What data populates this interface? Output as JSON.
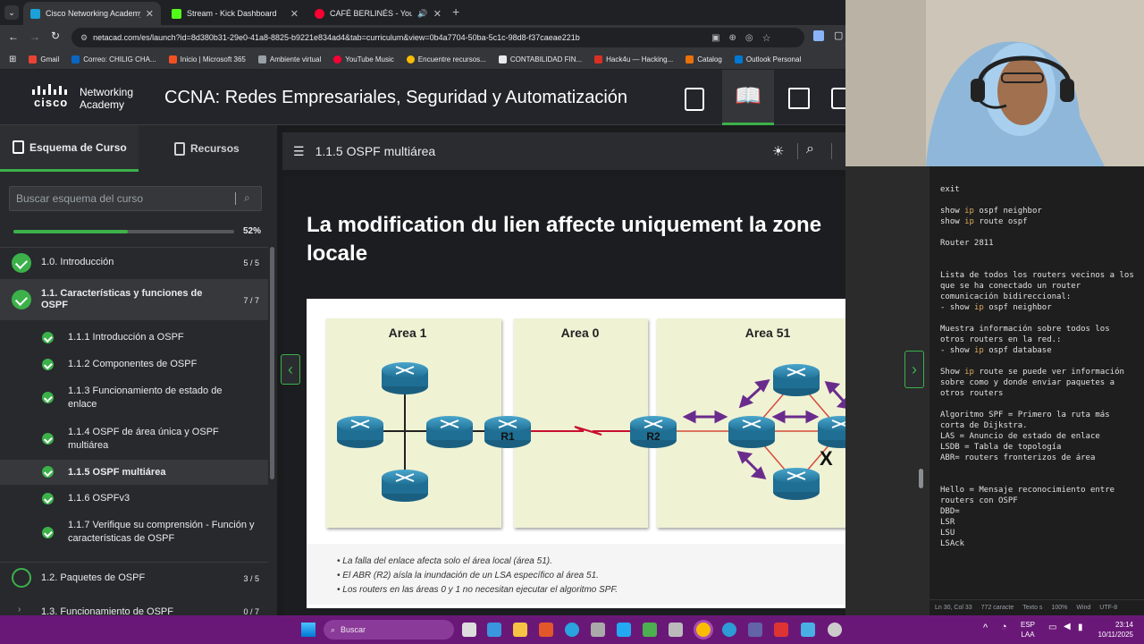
{
  "browser": {
    "tabs": [
      {
        "title": "Cisco Networking Academy: CC",
        "color": "#1ba0d7",
        "active": true
      },
      {
        "title": "Stream - Kick Dashboard",
        "color": "#53fc18",
        "active": false
      },
      {
        "title": "CAFÉ BERLINÉS - YouTube",
        "color": "#ff0033",
        "active": false
      }
    ],
    "new_tab": "+",
    "url": "netacad.com/es/launch?id=8d380b31-29e0-41a8-8825-b9221e834ad4&tab=curriculum&view=0b4a7704-50ba-5c1c-98d8-f37caeae221b",
    "bookmarks": [
      "Gmail",
      "Correo: CHILIG CHA...",
      "Inicio | Microsoft 365",
      "Ambiente virtual",
      "YouTube Music",
      "Encuentre recursos...",
      "CONTABILIDAD FIN...",
      "Hack4u — Hacking...",
      "Catalog",
      "Outlook Personal"
    ]
  },
  "app": {
    "logo_brand": "cisco",
    "logo_line1": "Networking",
    "logo_line2": "Academy",
    "course_title": "CCNA: Redes Empresariales, Seguridad y Automatización"
  },
  "sidebar": {
    "tab_outline": "Esquema de Curso",
    "tab_resources": "Recursos",
    "search_placeholder": "Buscar esquema del curso",
    "progress_label": "52%",
    "progress_value": 0.52,
    "modules": [
      {
        "label": "1.0. Introducción",
        "count": "5 / 5"
      },
      {
        "label": "1.1. Características y funciones de OSPF",
        "count": "7 / 7"
      },
      {
        "label": "1.2. Paquetes de OSPF",
        "count": "3 / 5"
      },
      {
        "label": "1.3. Funcionamiento de OSPF",
        "count": "0 / 7"
      }
    ],
    "items": [
      "1.1.1 Introducción a OSPF",
      "1.1.2 Componentes de OSPF",
      "1.1.3 Funcionamiento de estado de enlace",
      "1.1.4 OSPF de área única y OSPF multiárea",
      "1.1.5 OSPF multiárea",
      "1.1.6 OSPFv3",
      "1.1.7 Verifique su comprensión - Función y características de OSPF"
    ]
  },
  "content": {
    "section_title": "1.1.5 OSPF multiárea",
    "heading": "La modification du lien affecte uniquement la zone locale",
    "areas": [
      "Area 1",
      "Area 0",
      "Area 51"
    ],
    "routers": [
      "R1",
      "R2"
    ],
    "failure_mark": "X",
    "bullets": [
      "La falla del enlace afecta solo el área local (área 51).",
      "El ABR (R2) aísla la inundación de un LSA específico al área 51.",
      "Los routers en las áreas 0 y 1 no necesitan ejecutar el algoritmo SPF."
    ]
  },
  "notes": {
    "lines": [
      "exit",
      "",
      "show ip ospf neighbor",
      "show ip route ospf",
      "",
      "Router 2811",
      "",
      "",
      "Lista de todos los routers vecinos a los",
      "que se ha conectado un router",
      "comunicación bidireccional:",
      "- show ip ospf neighbor",
      "",
      "Muestra información sobre todos los",
      "otros routers en la red.:",
      "- show ip ospf database",
      "",
      "Show ip route se puede ver información",
      "sobre como y donde enviar paquetes a",
      "otros routers",
      "",
      "Algoritmo SPF = Primero la ruta más",
      "corta de Dijkstra.",
      "LAS = Anuncio de estado de enlace",
      "LSDB = Tabla de topología",
      "ABR= routers fronterizos de área",
      "",
      "",
      "Hello = Mensaje reconocimiento entre",
      "routers con OSPF",
      "DBD=",
      "LSR",
      "LSU",
      "LSAck"
    ],
    "status": [
      "Ln 30, Col 33",
      "772 caracte",
      "Texto s",
      "100%",
      "Wind",
      "UTF-8"
    ]
  },
  "taskbar": {
    "search": "Buscar",
    "lang1": "ESP",
    "lang2": "LAA",
    "time": "23:14",
    "date": "10/11/2025"
  }
}
